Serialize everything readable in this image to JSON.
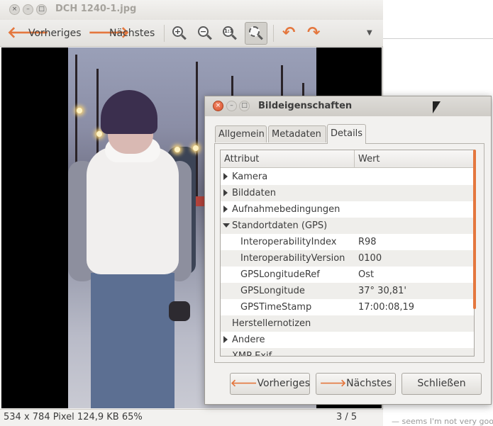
{
  "viewer": {
    "window_title": "DCH 1240-1.jpg",
    "window_buttons": {
      "close": "×",
      "minimize": "–",
      "maximize": "□"
    },
    "toolbar": {
      "prev_label": "Vorheriges",
      "next_label": "Nächstes",
      "zoom_in_icon": "+",
      "zoom_out_icon": "−",
      "zoom_normal_icon": "1:1",
      "rotate_left_icon": "↶",
      "rotate_right_icon": "↷",
      "menu_icon": "▼"
    },
    "status": {
      "image_info": "534 x 784 Pixel  124,9 KB    65%",
      "position": "3 / 5"
    }
  },
  "dialog": {
    "title": "Bildeigenschaften",
    "close_glyph": "×",
    "min_glyph": "–",
    "max_glyph": "□",
    "tabs": [
      {
        "label": "Allgemein"
      },
      {
        "label": "Metadaten"
      },
      {
        "label": "Details"
      }
    ],
    "active_tab": "Details",
    "columns": {
      "attribute": "Attribut",
      "value": "Wert"
    },
    "rows": [
      {
        "label": "Kamera",
        "value": "",
        "expander": "closed"
      },
      {
        "label": "Bilddaten",
        "value": "",
        "expander": "closed"
      },
      {
        "label": "Aufnahmebedingungen",
        "value": "",
        "expander": "closed"
      },
      {
        "label": "Standortdaten (GPS)",
        "value": "",
        "expander": "open"
      },
      {
        "label": "InteroperabilityIndex",
        "value": "R98",
        "expander": "none"
      },
      {
        "label": "InteroperabilityVersion",
        "value": "0100",
        "expander": "none"
      },
      {
        "label": "GPSLongitudeRef",
        "value": "Ost",
        "expander": "none"
      },
      {
        "label": "GPSLongitude",
        "value": "37° 30,81'",
        "expander": "none"
      },
      {
        "label": "GPSTimeStamp",
        "value": "17:00:08,19",
        "expander": "none"
      },
      {
        "label": "Herstellernotizen",
        "value": "",
        "expander": "none"
      },
      {
        "label": "Andere",
        "value": "",
        "expander": "closed"
      },
      {
        "label": "XMP Exif",
        "value": "",
        "expander": "none"
      }
    ],
    "buttons": {
      "prev": "Vorheriges",
      "next": "Nächstes",
      "close": "Schließen"
    }
  },
  "background_page": {
    "caption": "— seems I'm not very goo"
  },
  "colors": {
    "accent": "#e4773e",
    "close_button": "#d8502b"
  }
}
